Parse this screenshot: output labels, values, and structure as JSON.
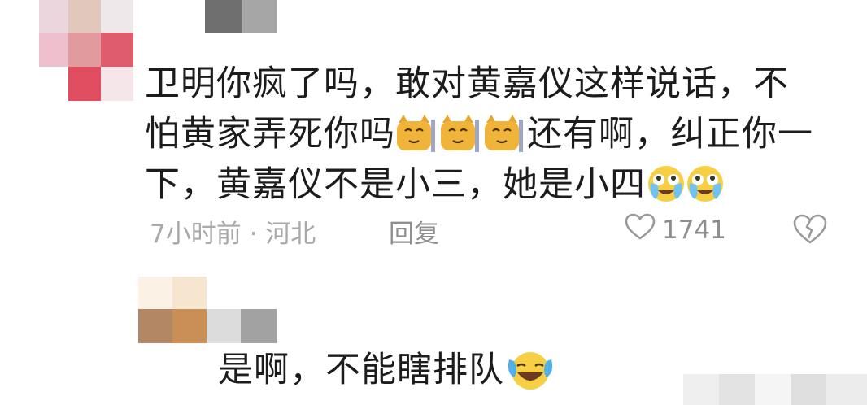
{
  "comment": {
    "avatar": "blurred-avatar",
    "username": "blurred-username",
    "lines": [
      "卫明你疯了吗，敢对黄嘉仪这样说话，不",
      "怕黄家弄死你吗",
      "还有啊，纠正你一",
      "下，黄嘉仪不是小三，她是小四"
    ],
    "meta": "7小时前 · 河北",
    "reply_label": "回复",
    "like_count": "1741",
    "like_icon": "heart-outline-icon",
    "dislike_icon": "broken-heart-icon"
  },
  "reply": {
    "avatar": "blurred-avatar",
    "username": "blurred-username",
    "text": "是啊，不能瞎排队",
    "emoji": "laughing-tears-emoji"
  },
  "colors": {
    "text": "#1c1c1c",
    "meta": "#a9a9a9",
    "action": "#8f8f8f",
    "background": "#ffffff"
  }
}
